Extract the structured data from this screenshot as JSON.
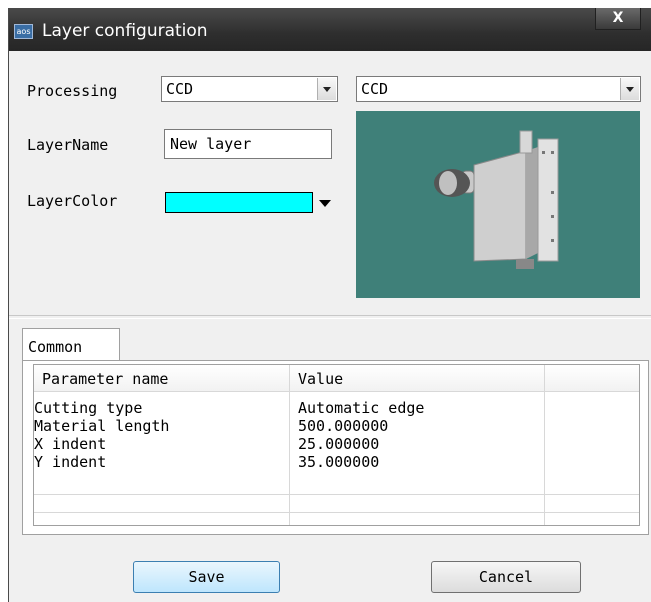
{
  "window": {
    "title": "Layer configuration",
    "close_glyph": "X",
    "icon_text": "aos"
  },
  "form": {
    "processing_label": "Processing",
    "processing_value": "CCD",
    "preview_select_value": "CCD",
    "layername_label": "LayerName",
    "layername_value": "New layer",
    "layercolor_label": "LayerColor",
    "layercolor_value": "#00ffff"
  },
  "tabs": [
    {
      "label": "Common"
    }
  ],
  "table": {
    "columns": [
      "Parameter name",
      "Value",
      ""
    ],
    "rows": [
      [
        "Cutting type",
        "Automatic edge"
      ],
      [
        "Material length",
        "500.000000"
      ],
      [
        "X indent",
        "25.000000"
      ],
      [
        "Y indent",
        "35.000000"
      ]
    ]
  },
  "buttons": {
    "save": "Save",
    "cancel": "Cancel"
  },
  "colors": {
    "preview_bg": "#3f8079",
    "layer_color": "#00ffff",
    "titlebar": "#333333"
  }
}
